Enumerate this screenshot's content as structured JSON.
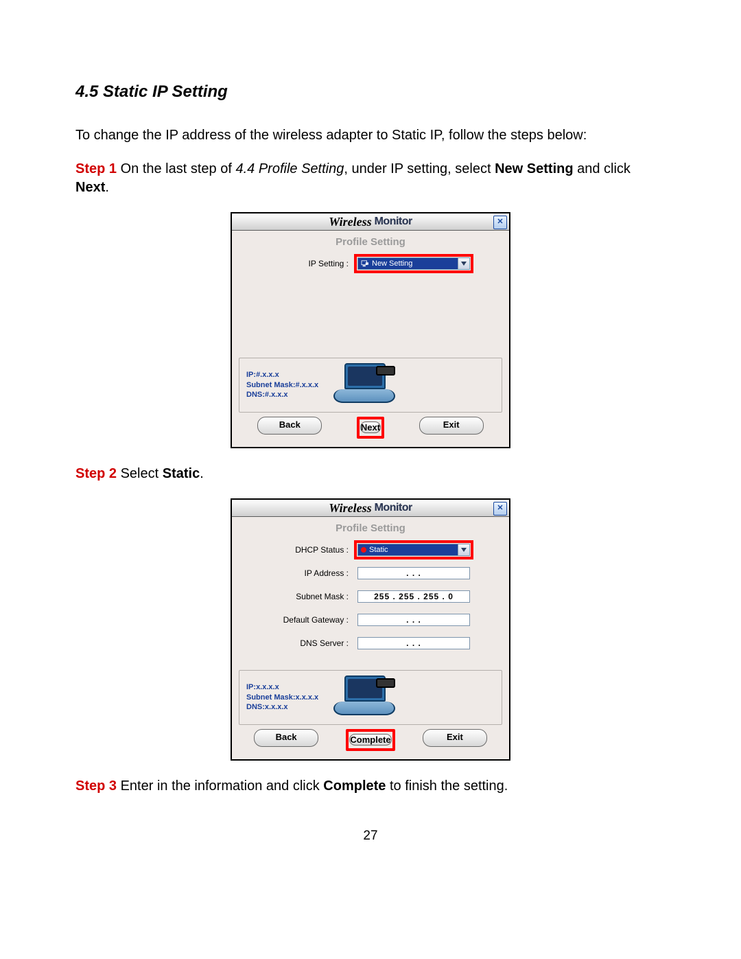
{
  "section": {
    "heading": "4.5 Static IP Setting"
  },
  "intro": "To change the IP address of the wireless adapter to Static IP, follow the steps below:",
  "step1": {
    "label": "Step 1",
    "t1": " On the last step of ",
    "ref": "4.4 Profile Setting",
    "t2": ", under IP setting, select ",
    "bold1": "New Setting",
    "t3": " and click ",
    "bold2": "Next",
    "t4": "."
  },
  "step2": {
    "label": "Step 2",
    "t1": " Select ",
    "bold1": "Static",
    "t2": "."
  },
  "step3": {
    "label": "Step 3",
    "t1": " Enter in the information and click ",
    "bold1": "Complete",
    "t2": " to finish the setting."
  },
  "dialog": {
    "brandA": "Wireless",
    "brandB": "Monitor",
    "close": "✕",
    "subhead": "Profile Setting",
    "panel": {
      "ip_pfx": "IP:",
      "ip_val1": "#.x.x.x",
      "ip_val2": "x.x.x.x",
      "mask_pfx": "Subnet Mask:",
      "mask_val1": "#.x.x.x",
      "mask_val2": "x.x.x.x",
      "dns_pfx": "DNS:",
      "dns_val1": "#.x.x.x",
      "dns_val2": "x.x.x.x"
    },
    "buttons": {
      "back": "Back",
      "next": "Next",
      "complete": "Complete",
      "exit": "Exit"
    },
    "form1": {
      "ip_setting_label": "IP Setting :",
      "ip_setting_value": "New Setting"
    },
    "form2": {
      "dhcp_label": "DHCP Status :",
      "dhcp_value": "Static",
      "ipaddr_label": "IP Address :",
      "ipaddr_value": ".       .       .",
      "mask_label": "Subnet Mask :",
      "mask_value": "255 . 255 . 255 .  0",
      "gw_label": "Default Gateway :",
      "gw_value": ".       .       .",
      "dns_label": "DNS Server :",
      "dns_value": ".       .       ."
    }
  },
  "page_number": "27"
}
